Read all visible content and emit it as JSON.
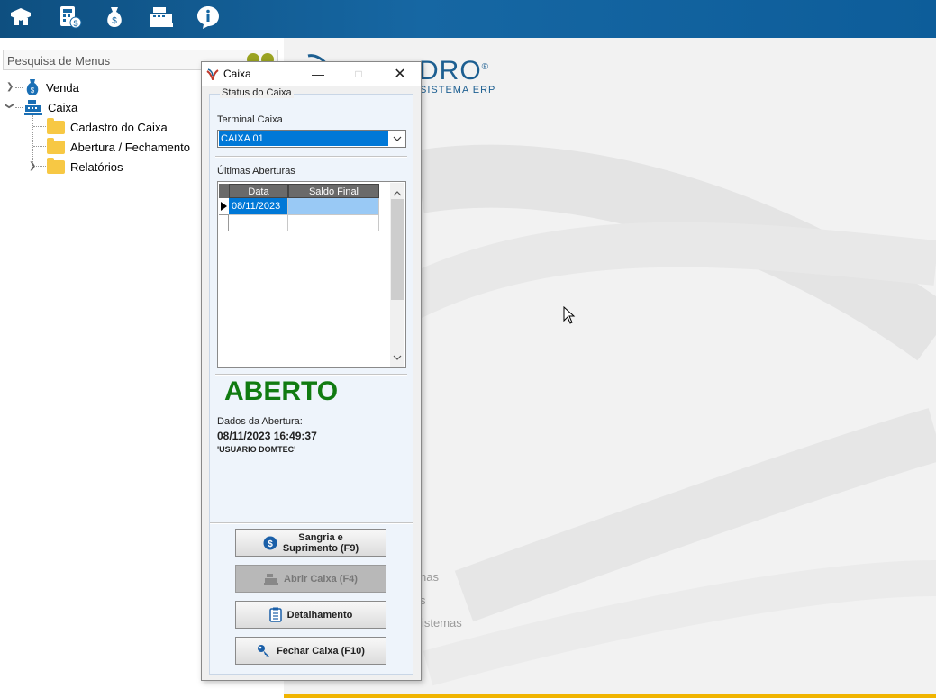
{
  "toolbar": {
    "icons": [
      "shipping-icon",
      "calculator-money-icon",
      "money-bag-icon",
      "cash-register-icon",
      "info-icon"
    ]
  },
  "sidebar": {
    "search_placeholder": "Pesquisa de Menus",
    "items": [
      {
        "label": "Venda"
      },
      {
        "label": "Caixa"
      },
      {
        "label": "Cadastro do Caixa"
      },
      {
        "label": "Abertura / Fechamento"
      },
      {
        "label": "Relatórios"
      }
    ]
  },
  "background": {
    "logo_text": "DRO",
    "logo_reg": "®",
    "logo_sub": "SISTEMA ERP",
    "links": [
      "nas",
      "s",
      "istemas"
    ]
  },
  "dialog": {
    "title": "Caixa",
    "group_title": "Status do Caixa",
    "terminal_label": "Terminal Caixa",
    "terminal_value": "CAIXA 01",
    "last_openings_label": "Últimas Aberturas",
    "grid": {
      "columns": [
        "Data",
        "Saldo Final"
      ],
      "rows": [
        {
          "data": "08/11/2023",
          "saldo": ""
        }
      ]
    },
    "status_text": "ABERTO",
    "open_data_label": "Dados da Abertura:",
    "open_datetime": "08/11/2023 16:49:37",
    "open_user": "'USUARIO DOMTEC'",
    "buttons": {
      "sangria_line1": "Sangria e",
      "sangria_line2": "Suprimento (F9)",
      "abrir": "Abrir Caixa (F4)",
      "detalhamento": "Detalhamento",
      "fechar": "Fechar Caixa (F10)"
    }
  },
  "colors": {
    "toolbar": "#1667a3",
    "status_open": "#117b11",
    "selection": "#0078d7",
    "accent_line": "#f0b400"
  }
}
